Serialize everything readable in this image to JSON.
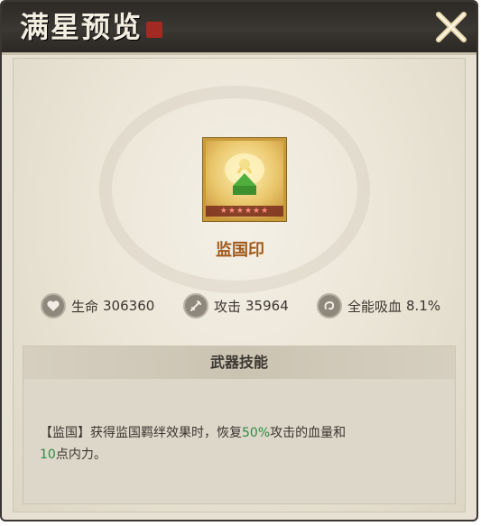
{
  "window": {
    "title": "满星预览"
  },
  "item": {
    "name": "监国印",
    "stars": "★★★★★★"
  },
  "stats": [
    {
      "label": "生命",
      "value": "306360",
      "icon": "heart-icon"
    },
    {
      "label": "攻击",
      "value": "35964",
      "icon": "sword-icon"
    },
    {
      "label": "全能吸血",
      "value": "8.1%",
      "icon": "swirl-icon"
    }
  ],
  "skill": {
    "header": "武器技能",
    "desc": {
      "part1": "【监国】获得监国羁绊效果时，恢复",
      "highlight1": "50%",
      "part2": "攻击的血量和",
      "highlight2": "10",
      "part3": "点内力。"
    }
  },
  "colors": {
    "highlight": "#2f8a46",
    "item_name": "#a05a1c",
    "frame_gold": "#c99a3a"
  }
}
